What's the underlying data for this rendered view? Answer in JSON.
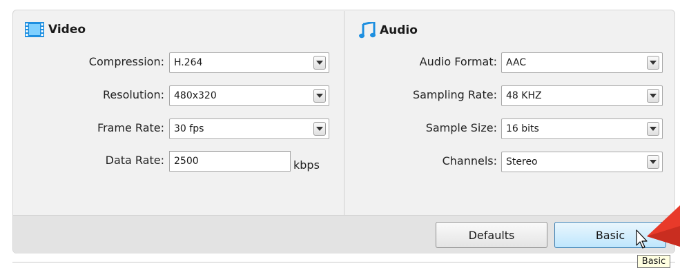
{
  "video": {
    "title": "Video",
    "icon": "film-icon",
    "compression": {
      "label": "Compression:",
      "value": "H.264"
    },
    "resolution": {
      "label": "Resolution:",
      "value": "480x320"
    },
    "frame_rate": {
      "label": "Frame Rate:",
      "value": "30 fps"
    },
    "data_rate": {
      "label": "Data Rate:",
      "value": "2500",
      "unit": "kbps"
    }
  },
  "audio": {
    "title": "Audio",
    "icon": "music-note-icon",
    "audio_format": {
      "label": "Audio Format:",
      "value": "AAC"
    },
    "sampling_rate": {
      "label": "Sampling Rate:",
      "value": "48 KHZ"
    },
    "sample_size": {
      "label": "Sample Size:",
      "value": "16 bits"
    },
    "channels": {
      "label": "Channels:",
      "value": "Stereo"
    }
  },
  "buttons": {
    "defaults_label": "Defaults",
    "basic_label": "Basic"
  },
  "tooltip": {
    "text": "Basic"
  },
  "colors": {
    "accent_blue": "#1e90e0",
    "pointer_red": "#e83a2a",
    "button_active": "#bee6fd"
  }
}
